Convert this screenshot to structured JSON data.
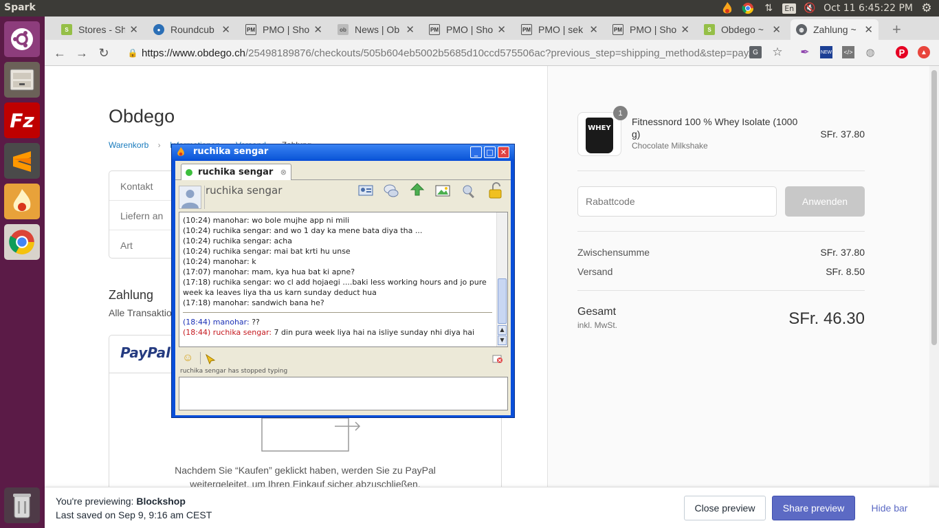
{
  "system_bar": {
    "app_name": "Spark",
    "language": "En",
    "clock": "Oct 11  6:45:22 PM"
  },
  "browser": {
    "tabs": [
      {
        "label": "Stores - Sh",
        "favicon": "shopify-icon"
      },
      {
        "label": "Roundcub",
        "favicon": "roundcube-icon"
      },
      {
        "label": "PMO | Sho",
        "favicon": "pmo-icon"
      },
      {
        "label": "News | Ob",
        "favicon": "news-icon"
      },
      {
        "label": "PMO | Sho",
        "favicon": "pmo-icon"
      },
      {
        "label": "PMO | sek",
        "favicon": "pmo-icon"
      },
      {
        "label": "PMO | Sho",
        "favicon": "pmo-icon"
      },
      {
        "label": "Obdego ~",
        "favicon": "shopify-icon"
      },
      {
        "label": "Zahlung ~",
        "favicon": "globe-icon"
      }
    ],
    "url_host": "https://www.obdego.ch",
    "url_path": "/25498189876/checkouts/505b604eb5002b5685d10ccd575506ac?previous_step=shipping_method&step=pay..."
  },
  "checkout": {
    "store_name": "Obdego",
    "breadcrumb": [
      "Warenkorb",
      "Informationen",
      "Versand",
      "Zahlung"
    ],
    "review": [
      {
        "label": "Kontakt"
      },
      {
        "label": "Liefern an"
      },
      {
        "label": "Art"
      }
    ],
    "payment_title": "Zahlung",
    "payment_subtitle": "Alle Transaktionen sind sicher und verschlüsselt.",
    "paypal_label": "PayPal",
    "paypal_text_1": "Nachdem Sie “Kaufen” geklickt haben, werden Sie zu PayPal",
    "paypal_text_2": "weitergeleitet, um Ihren Einkauf sicher abzuschließen."
  },
  "summary": {
    "product_name": "Fitnessnord 100 % Whey Isolate (1000 g)",
    "product_variant": "Chocolate Milkshake",
    "product_price": "SFr. 37.80",
    "product_qty": "1",
    "product_image_text": "WHEY",
    "discount_placeholder": "Rabattcode",
    "apply_label": "Anwenden",
    "subtotal_label": "Zwischensumme",
    "subtotal_value": "SFr. 37.80",
    "shipping_label": "Versand",
    "shipping_value": "SFr. 8.50",
    "total_label": "Gesamt",
    "total_sub": "inkl. MwSt.",
    "total_value": "SFr. 46.30"
  },
  "preview_bar": {
    "line1_prefix": "You're previewing: ",
    "theme": "Blockshop",
    "line2": "Last saved on Sep 9, 9:16 am CEST",
    "close_label": "Close preview",
    "share_label": "Share preview",
    "hide_label": "Hide bar"
  },
  "chat": {
    "window_title": "ruchika sengar",
    "tab_label": "ruchika sengar",
    "contact_name": "ruchika sengar",
    "history": [
      {
        "time": "(10:24)",
        "sender": "manohar",
        "text": "wo bole mujhe app ni mili"
      },
      {
        "time": "(10:24)",
        "sender": "ruchika sengar",
        "text": "and wo 1 day ka mene bata diya tha ..."
      },
      {
        "time": "(10:24)",
        "sender": "ruchika sengar",
        "text": "acha"
      },
      {
        "time": "(10:24)",
        "sender": "ruchika sengar",
        "text": "mai bat krti hu unse"
      },
      {
        "time": "(10:24)",
        "sender": "manohar",
        "text": "k"
      },
      {
        "time": "(17:07)",
        "sender": "manohar",
        "text": "mam, kya hua bat ki apne?"
      },
      {
        "time": "(17:18)",
        "sender": "ruchika sengar",
        "text": "wo cl add hojaegi ....baki less working hours and jo pure week ka leaves liya tha us karn sunday deduct hua"
      },
      {
        "time": "(17:18)",
        "sender": "manohar",
        "text": "sandwich bana he?"
      }
    ],
    "recent": [
      {
        "time": "(18:44)",
        "sender": "manohar",
        "text": "??",
        "color": "#1a2fb5"
      },
      {
        "time": "(18:44)",
        "sender": "ruchika sengar",
        "text": "7 din pura week liya hai na isliye sunday nhi diya hai",
        "color": "#c4161c"
      }
    ],
    "typing_status": "ruchika sengar has stopped typing"
  },
  "colors": {
    "launcher_bg": "#5b1b47",
    "preview_button": "#5c6ac4",
    "link": "#197bbd",
    "chat_frame": "#0a4fd9"
  }
}
